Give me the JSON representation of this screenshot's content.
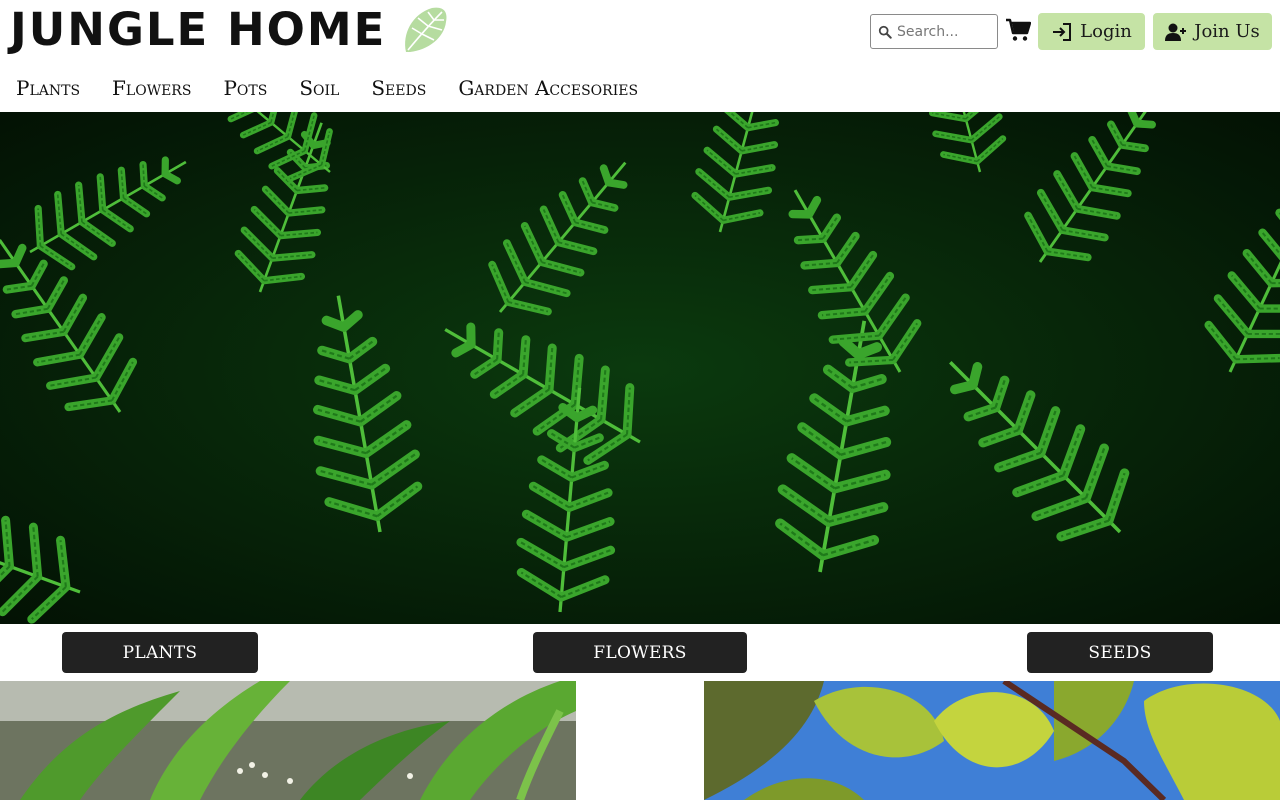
{
  "brand": {
    "name": "JUNGLE HOME",
    "leaf_icon": "monstera-leaf-icon",
    "leaf_color": "#b6dca0"
  },
  "search": {
    "placeholder": "Search..."
  },
  "cart": {
    "icon": "cart-icon"
  },
  "buttons": {
    "login": {
      "label": "Login",
      "icon": "sign-in-icon"
    },
    "join": {
      "label": "Join Us",
      "icon": "user-plus-icon"
    },
    "accent": "#c5e3a5"
  },
  "nav": {
    "items": [
      {
        "label": "Plants"
      },
      {
        "label": "Flowers"
      },
      {
        "label": "Pots"
      },
      {
        "label": "Soil"
      },
      {
        "label": "Seeds"
      },
      {
        "label": "Garden Accesories"
      }
    ]
  },
  "hero": {
    "image": "fern-foliage-image"
  },
  "categories": [
    {
      "label": "PLANTS"
    },
    {
      "label": "FLOWERS"
    },
    {
      "label": "SEEDS"
    }
  ],
  "gallery": {
    "left_image": "green-plant-photo",
    "right_image": "leaves-sky-photo"
  }
}
